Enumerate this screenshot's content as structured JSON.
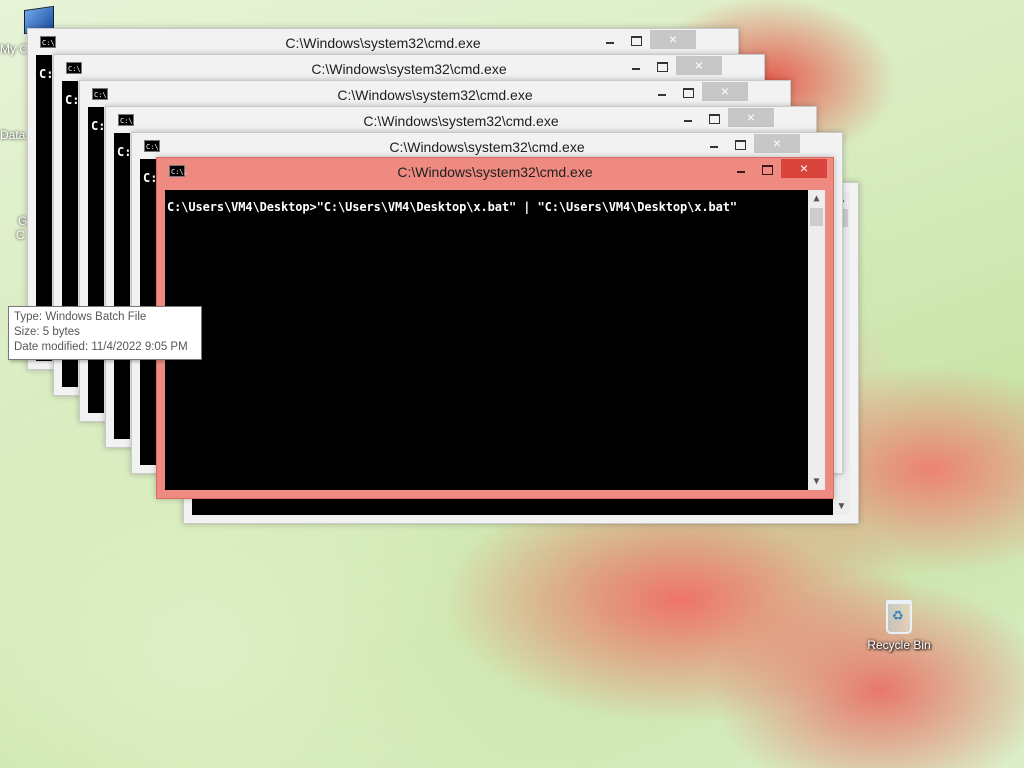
{
  "desktop": {
    "left_fragments": [
      "My C",
      "Data",
      "G",
      "C"
    ],
    "recycle_bin_label": "Recycle Bin"
  },
  "window_title": "C:\\Windows\\system32\\cmd.exe",
  "cmd_icon_text": "C:\\.",
  "close_symbol": "×",
  "stacked_prompt_fragment": "C:",
  "active_window": {
    "command_line": "C:\\Users\\VM4\\Desktop>\"C:\\Users\\VM4\\Desktop\\x.bat\" | \"C:\\Users\\VM4\\Desktop\\x.bat\""
  },
  "scroll_up_symbol": "▲",
  "scroll_down_symbol": "▼",
  "tooltip": {
    "type": "Type: Windows Batch File",
    "size": "Size: 5 bytes",
    "date": "Date modified: 11/4/2022 9:05 PM"
  },
  "colors": {
    "active_frame": "#ef8a80",
    "active_close": "#d9453d",
    "inactive_frame": "#f2f2f2"
  }
}
